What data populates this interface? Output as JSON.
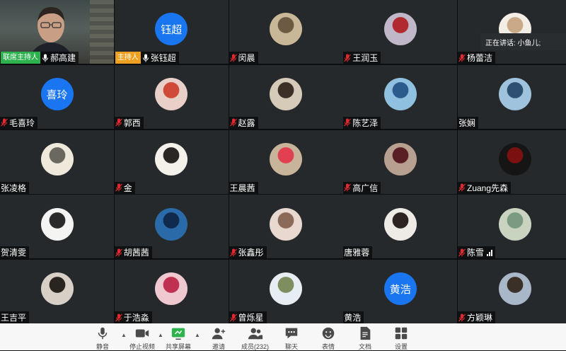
{
  "speaking_indicator": "正在讲话: 小鱼儿;",
  "tiles": [
    {
      "name": "郝高建",
      "badge": "联席主持人",
      "badge_type": "cohost",
      "kind": "video",
      "mic": "on"
    },
    {
      "name": "张钰超",
      "badge": "主持人",
      "badge_type": "host",
      "kind": "initials",
      "initials": "钰超",
      "mic": "on"
    },
    {
      "name": "闵晨",
      "kind": "photo",
      "colors": [
        "#c9b898",
        "#6d5a42"
      ],
      "mic": "muted"
    },
    {
      "name": "王润玉",
      "kind": "photo",
      "colors": [
        "#c0b8c8",
        "#b02a30"
      ],
      "mic": "muted"
    },
    {
      "name": "杨蕾洁",
      "kind": "photo",
      "colors": [
        "#f2eee6",
        "#c9a987"
      ],
      "mic": "muted"
    },
    {
      "name": "毛喜玲",
      "kind": "initials",
      "initials": "喜玲",
      "mic": "muted"
    },
    {
      "name": "郭西",
      "kind": "photo",
      "colors": [
        "#e8d0c8",
        "#d04a3a"
      ],
      "mic": "muted"
    },
    {
      "name": "赵露",
      "kind": "photo",
      "colors": [
        "#d6cab8",
        "#3c3028"
      ],
      "mic": "muted"
    },
    {
      "name": "陈艺泽",
      "kind": "photo",
      "colors": [
        "#8fc0e0",
        "#2b5a8c"
      ],
      "mic": "muted"
    },
    {
      "name": "张娴",
      "kind": "photo",
      "colors": [
        "#9fc3dd",
        "#2f4f72"
      ],
      "mic": "none"
    },
    {
      "name": "张凌格",
      "kind": "photo",
      "colors": [
        "#efe9dc",
        "#6b6860"
      ],
      "mic": "none"
    },
    {
      "name": "金",
      "kind": "photo",
      "colors": [
        "#f4f0ea",
        "#2a2624"
      ],
      "mic": "muted"
    },
    {
      "name": "王晨茜",
      "kind": "photo",
      "colors": [
        "#c8b49a",
        "#e04050"
      ],
      "mic": "none"
    },
    {
      "name": "高广信",
      "kind": "photo",
      "colors": [
        "#b8a090",
        "#5a1f24"
      ],
      "mic": "muted"
    },
    {
      "name": "Zuang先森",
      "kind": "photo",
      "colors": [
        "#151515",
        "#7a1010"
      ],
      "mic": "muted"
    },
    {
      "name": "贺清雯",
      "kind": "photo",
      "colors": [
        "#f4f4f2",
        "#2a2a2a"
      ],
      "mic": "none"
    },
    {
      "name": "胡茜茜",
      "kind": "photo",
      "colors": [
        "#2a6aa8",
        "#0f2a4c"
      ],
      "mic": "muted"
    },
    {
      "name": "张鑫彤",
      "kind": "photo",
      "colors": [
        "#e8d8d0",
        "#8c6a5a"
      ],
      "mic": "muted"
    },
    {
      "name": "唐雅蓉",
      "kind": "photo",
      "colors": [
        "#eeeae6",
        "#2c2422"
      ],
      "mic": "none"
    },
    {
      "name": "陈雪",
      "kind": "photo",
      "colors": [
        "#c8d4c0",
        "#7a9a82"
      ],
      "mic": "muted",
      "signal": true
    },
    {
      "name": "王吉平",
      "kind": "photo",
      "colors": [
        "#d8d0c6",
        "#2a2420"
      ],
      "mic": "none"
    },
    {
      "name": "于浩淼",
      "kind": "photo",
      "colors": [
        "#f0c8d0",
        "#c03050"
      ],
      "mic": "muted"
    },
    {
      "name": "曾烁星",
      "kind": "photo",
      "colors": [
        "#e6eef4",
        "#7d8f5e"
      ],
      "mic": "muted"
    },
    {
      "name": "黄浩",
      "kind": "initials",
      "initials": "黄浩",
      "mic": "none"
    },
    {
      "name": "方颖琳",
      "kind": "photo",
      "colors": [
        "#a8b8c8",
        "#3a3028"
      ],
      "mic": "muted"
    }
  ],
  "toolbar": {
    "mute": "静音",
    "stop_video": "停止视频",
    "share_screen": "共享屏幕",
    "invite": "邀请",
    "participants": "成员(232)",
    "chat": "聊天",
    "reactions": "表情",
    "documents": "文档",
    "settings": "设置"
  },
  "colors": {
    "tile_bg": "#26292c",
    "initials_bg": "#1976f0",
    "cohost_badge": "#2eb24e",
    "host_badge": "#f0a020",
    "muted_mic": "#e0292e"
  }
}
